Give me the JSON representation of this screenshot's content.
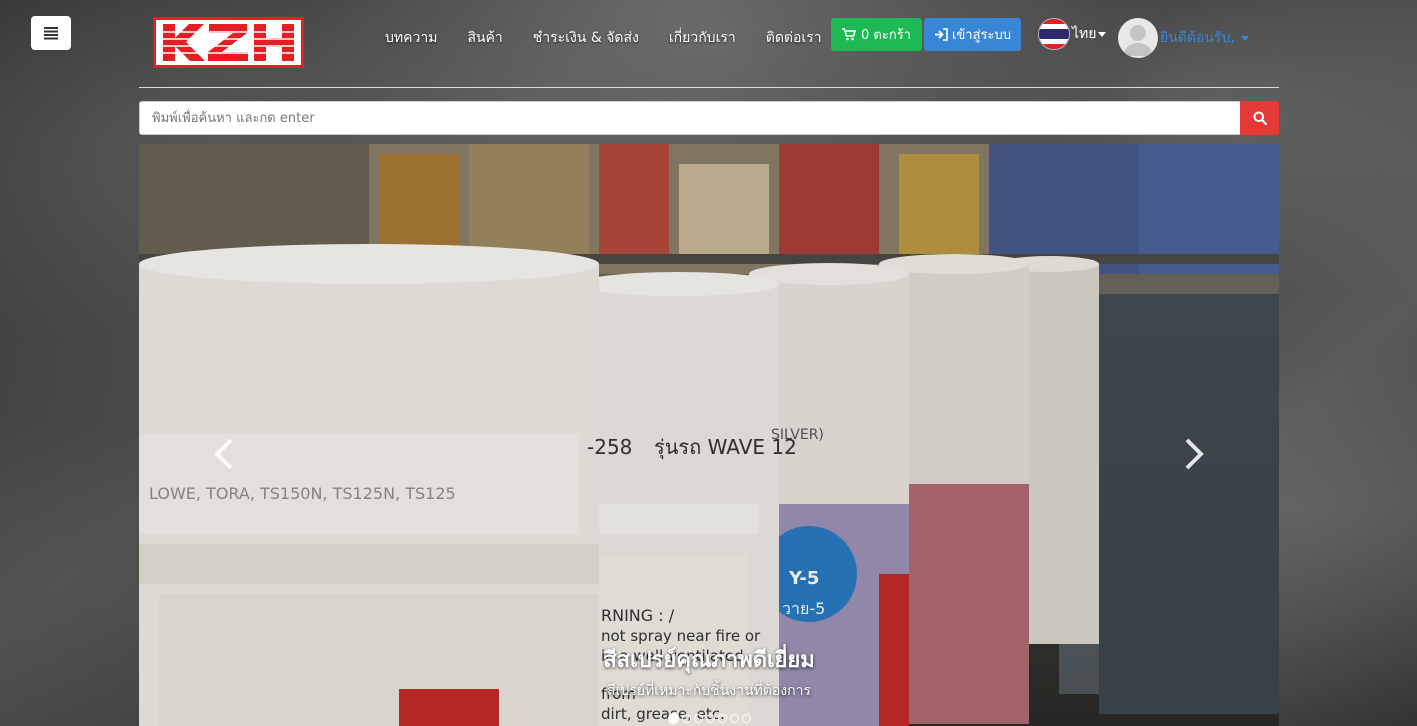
{
  "header": {
    "logo_text": "KZH",
    "nav": [
      {
        "label": "บทความ"
      },
      {
        "label": "สินค้า"
      },
      {
        "label": "ชำระเงิน & จัดส่ง"
      },
      {
        "label": "เกี่ยวกับเรา"
      },
      {
        "label": "ติดต่อเรา"
      }
    ],
    "cart_label": "0 ตะกร้า",
    "login_label": "เข้าสู่ระบบ",
    "language_label": "ไทย",
    "user_greeting": "ยินดีต้อนรับ,"
  },
  "search": {
    "placeholder": "พิมพ์เพื่อค้นหา และกด enter"
  },
  "carousel": {
    "caption_title": "สีสเปรย์คุณภาพดีเยี่ยม",
    "caption_subtitle": "สีเปรย์ที่เหมาะกับชิ้นงานที่ต้องการ",
    "slide_count": 7,
    "active_index": 0,
    "can_labels": [
      "LOWE, TORA, TS150N, TS125N, TS125",
      "-258",
      "รุ่นรถ WAVE 12",
      "SILVER)",
      "Y-5",
      "วาย-5",
      "RNING : /",
      "not spray near fire or",
      "in a well ventilated",
      "from",
      "dirt, grease, etc."
    ]
  },
  "colors": {
    "cart_button": "#1db954",
    "login_button": "#3a86d6",
    "search_button": "#e53935",
    "logo_red": "#e31e24"
  }
}
